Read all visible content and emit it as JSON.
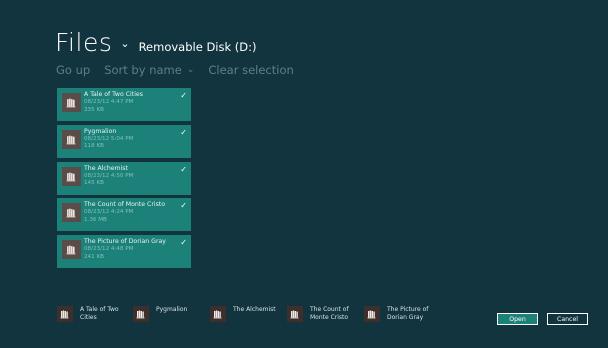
{
  "header": {
    "title": "Files",
    "title_chevron": "⌄",
    "location": "Removable Disk (D:)"
  },
  "commands": {
    "go_up": "Go up",
    "sort_by_name": "Sort by name",
    "sort_chevron": "⌄",
    "clear_selection": "Clear selection"
  },
  "files": [
    {
      "name": "A Tale of Two Cities",
      "date": "08/23/12 4:47 PM",
      "size": "335 KB",
      "selected": true
    },
    {
      "name": "Pygmalion",
      "date": "08/23/12 5:04 PM",
      "size": "118 KB",
      "selected": true
    },
    {
      "name": "The Alchemist",
      "date": "08/23/12 4:50 PM",
      "size": "145 KB",
      "selected": true
    },
    {
      "name": "The Count of Monte Cristo",
      "date": "08/23/12 4:24 PM",
      "size": "1.36 MB",
      "selected": true
    },
    {
      "name": "The Picture of Dorian Gray",
      "date": "08/23/12 4:48 PM",
      "size": "241 KB",
      "selected": true
    }
  ],
  "basket": [
    {
      "line1": "A Tale of Two",
      "line2": "Cities"
    },
    {
      "line1": "Pygmalion",
      "line2": ""
    },
    {
      "line1": "The Alchemist",
      "line2": ""
    },
    {
      "line1": "The Count of",
      "line2": "Monte Cristo"
    },
    {
      "line1": "The Picture of",
      "line2": "Dorian Gray"
    }
  ],
  "buttons": {
    "open": "Open",
    "cancel": "Cancel"
  },
  "check_glyph": "✓",
  "icon_name": "book-library-icon",
  "colors": {
    "background": "#12343f",
    "tile": "#1c8179",
    "icon_bg": "#5a4d49",
    "command_text": "#5f7e88"
  }
}
